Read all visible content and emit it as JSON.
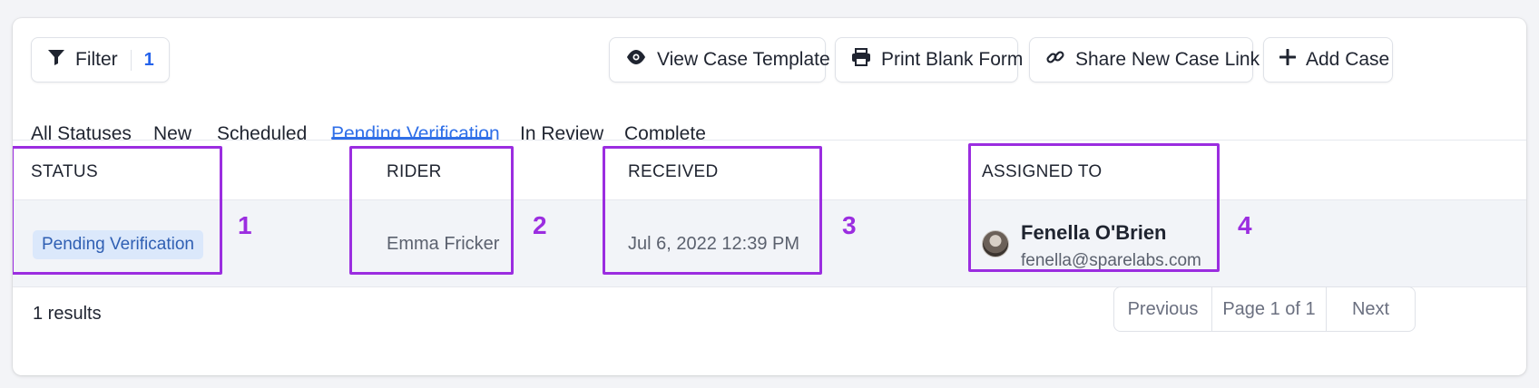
{
  "toolbar": {
    "filter_label": "Filter",
    "filter_count": "1",
    "view_template_label": "View Case Template",
    "print_form_label": "Print Blank Form",
    "share_link_label": "Share New Case Link",
    "add_case_label": "Add Case"
  },
  "tabs": [
    {
      "label": "All Statuses",
      "active": false
    },
    {
      "label": "New",
      "active": false
    },
    {
      "label": "Scheduled",
      "active": false
    },
    {
      "label": "Pending Verification",
      "active": true
    },
    {
      "label": "In Review",
      "active": false
    },
    {
      "label": "Complete",
      "active": false
    }
  ],
  "table": {
    "headers": {
      "status": "STATUS",
      "rider": "RIDER",
      "received": "RECEIVED",
      "assigned_to": "ASSIGNED TO"
    },
    "rows": [
      {
        "status": "Pending Verification",
        "rider": "Emma Fricker",
        "received": "Jul 6, 2022 12:39 PM",
        "assignee_name": "Fenella O'Brien",
        "assignee_email": "fenella@sparelabs.com"
      }
    ]
  },
  "annotations": [
    "1",
    "2",
    "3",
    "4"
  ],
  "footer": {
    "results": "1 results",
    "previous_label": "Previous",
    "page_label": "Page 1 of 1",
    "next_label": "Next"
  },
  "colors": {
    "accent": "#2f6fe8",
    "highlight": "#9b2de0",
    "badge_bg": "#dbe8fb",
    "badge_text": "#2f5fb3"
  },
  "icons": {
    "filter": "filter-funnel-icon",
    "view": "eye-icon",
    "print": "printer-icon",
    "share": "link-icon",
    "add": "plus-icon"
  }
}
